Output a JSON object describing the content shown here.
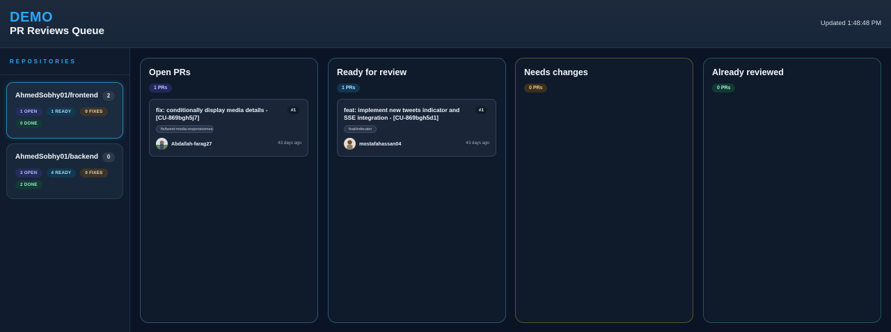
{
  "header": {
    "brand": "DEMO",
    "title": "PR Reviews Queue",
    "updated": "Updated 1:48:48 PM"
  },
  "sidebar": {
    "title": "REPOSITORIES",
    "repos": [
      {
        "name": "AhmedSobhy01/frontend",
        "count": "2",
        "open": "1 OPEN",
        "ready": "1 READY",
        "fixes": "0 FIXES",
        "done": "0 DONE"
      },
      {
        "name": "AhmedSobhy01/backend",
        "count": "0",
        "open": "3 OPEN",
        "ready": "4 READY",
        "fixes": "0 FIXES",
        "done": "2 DONE"
      }
    ]
  },
  "columns": [
    {
      "title": "Open PRs",
      "count": "1 PRs",
      "card": {
        "title": "fix: conditionally display media details - [CU-869bgh5j7]",
        "number": "#1",
        "branch": "fix/tweet-media-responsiveness",
        "author": "Abdallah-farag27",
        "ago": "43 days ago"
      }
    },
    {
      "title": "Ready for review",
      "count": "1 PRs",
      "card": {
        "title": "feat: implement new tweets indicator and SSE integration - [CU-869bgh5d1]",
        "number": "#1",
        "branch": "feat/indecator",
        "author": "mostafahassan04",
        "ago": "43 days ago"
      }
    },
    {
      "title": "Needs changes",
      "count": "0 PRs"
    },
    {
      "title": "Already reviewed",
      "count": "0 PRs"
    }
  ],
  "colors": {
    "accent": "#2aa7f5",
    "background": "#0b1424",
    "panel": "#0f1a2b"
  }
}
